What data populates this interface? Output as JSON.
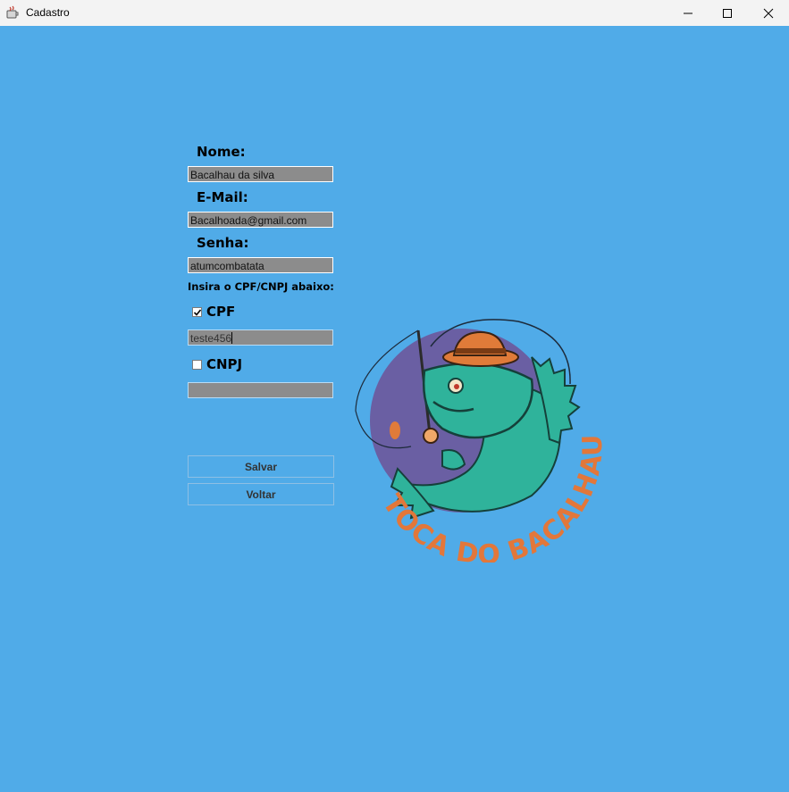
{
  "window": {
    "title": "Cadastro",
    "icons": {
      "app": "java-cup-icon",
      "minimize": "minimize-icon",
      "maximize": "maximize-icon",
      "close": "close-icon"
    }
  },
  "form": {
    "nome_label": "Nome:",
    "nome_value": "Bacalhau da silva",
    "email_label": "E-Mail:",
    "email_value": "Bacalhoada@gmail.com",
    "senha_label": "Senha:",
    "senha_value": "atumcombatata",
    "doc_prompt": "Insira o CPF/CNPJ abaixo:",
    "cpf_label": "CPF",
    "cpf_checked": true,
    "cpf_value": "teste456",
    "cnpj_label": "CNPJ",
    "cnpj_checked": false,
    "cnpj_value": ""
  },
  "buttons": {
    "salvar": "Salvar",
    "voltar": "Voltar"
  },
  "logo": {
    "text": "TOCA DO BACALHAU"
  },
  "colors": {
    "background": "#50abe8",
    "field": "#8c8c8c",
    "logo_circle": "#6a5fa3",
    "fish": "#2fb39b",
    "hat": "#e07b39",
    "logo_text": "#e2773a"
  }
}
